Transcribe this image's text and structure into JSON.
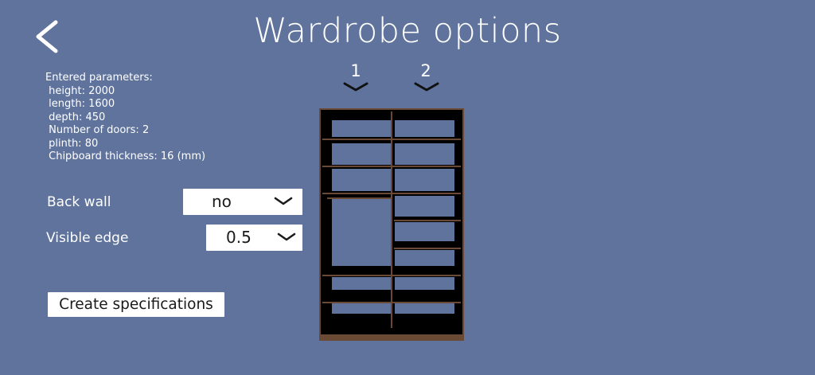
{
  "header": {
    "title": "Wardrobe options",
    "back_icon": "chevron-left-icon"
  },
  "parameters": {
    "heading": "Entered parameters:",
    "lines": [
      " height: 2000",
      " length: 1600",
      " depth: 450",
      " Number of doors: 2",
      " plinth: 80",
      " Chipboard thickness: 16 (mm)"
    ]
  },
  "options": {
    "back_wall": {
      "label": "Back wall",
      "value": "no",
      "icon": "chevron-down-icon"
    },
    "visible_edge": {
      "label": "Visible edge",
      "value": "0.5",
      "icon": "chevron-down-icon"
    }
  },
  "actions": {
    "create_specifications": "Create specifications"
  },
  "doors": [
    {
      "number": "1",
      "icon": "chevron-down-icon"
    },
    {
      "number": "2",
      "icon": "chevron-down-icon"
    }
  ],
  "colors": {
    "background": "#5f739c",
    "wardrobe_body": "#000000",
    "shelf": "#6b4a35",
    "text": "#ffffff"
  }
}
